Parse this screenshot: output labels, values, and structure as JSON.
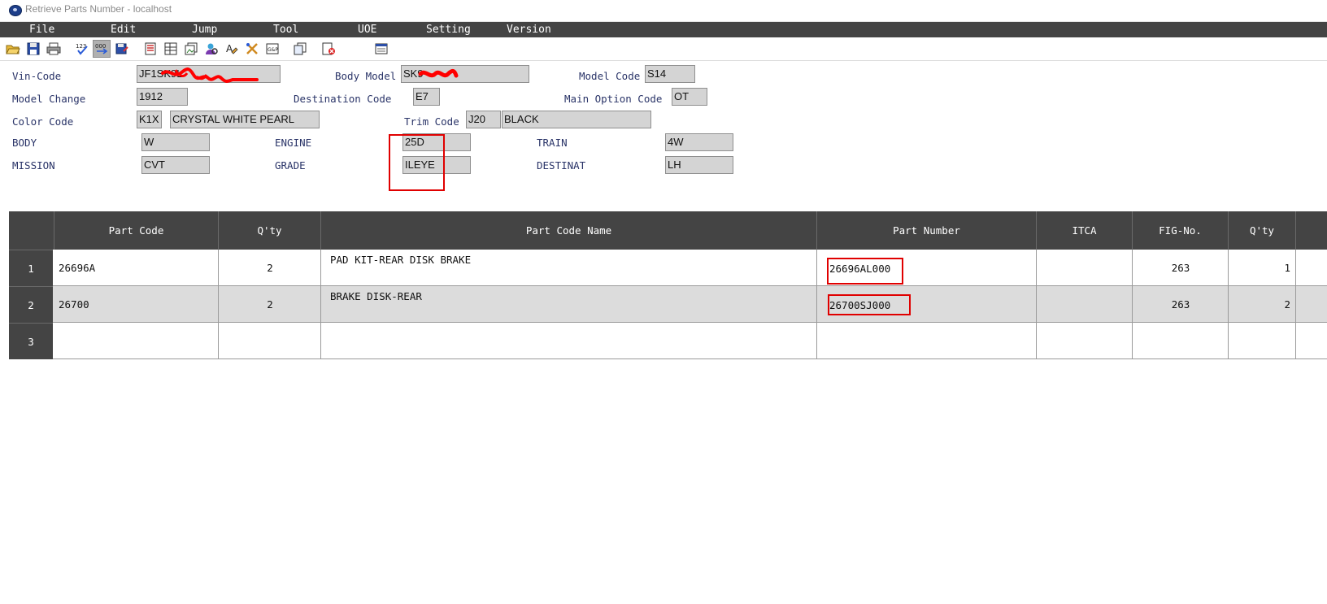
{
  "window": {
    "title": "Retrieve Parts Number - localhost"
  },
  "menu": [
    "File",
    "Edit",
    "Jump",
    "Tool",
    "UOE",
    "Setting",
    "Version"
  ],
  "toolbar_icons": [
    "open-folder-icon",
    "save-icon",
    "print-icon",
    "check-number-icon",
    "number-sequence-icon",
    "save-as-icon",
    "document-list-icon",
    "table-icon",
    "image-stack-icon",
    "search-person-icon",
    "text-edit-icon",
    "tools-icon",
    "gp-icon",
    "copy-documents-icon",
    "exit-icon",
    "window-icon"
  ],
  "form": {
    "vin_code": {
      "label": "Vin-Code",
      "value": "JF1SK9L"
    },
    "body_model": {
      "label": "Body Model",
      "value": "SK9"
    },
    "model_code": {
      "label": "Model Code",
      "value": "S14"
    },
    "model_change": {
      "label": "Model Change",
      "value": "1912"
    },
    "destination_code": {
      "label": "Destination Code",
      "value": "E7"
    },
    "main_option_code": {
      "label": "Main Option Code",
      "value": "OT"
    },
    "color_code": {
      "label": "Color Code",
      "code": "K1X",
      "name": "CRYSTAL WHITE PEARL"
    },
    "trim_code": {
      "label": "Trim Code",
      "code": "J20",
      "name": "BLACK"
    },
    "body": {
      "label": "BODY",
      "value": "W"
    },
    "engine": {
      "label": "ENGINE",
      "value": "25D"
    },
    "train": {
      "label": "TRAIN",
      "value": "4W"
    },
    "mission": {
      "label": "MISSION",
      "value": "CVT"
    },
    "grade": {
      "label": "GRADE",
      "value": "ILEYE"
    },
    "destinat": {
      "label": "DESTINAT",
      "value": "LH"
    }
  },
  "table": {
    "headers": {
      "part_code": "Part Code",
      "qty": "Q'ty",
      "part_code_name": "Part Code Name",
      "part_number": "Part Number",
      "itca": "ITCA",
      "fig_no": "FIG-No.",
      "qty2": "Q'ty"
    },
    "rows": [
      {
        "num": "1",
        "part_code": "26696A",
        "qty": "2",
        "part_code_name": "PAD KIT-REAR DISK BRAKE",
        "part_number": "26696AL000",
        "itca": "",
        "fig_no": "263",
        "qty2": "1"
      },
      {
        "num": "2",
        "part_code": "26700",
        "qty": "2",
        "part_code_name": "BRAKE DISK-REAR",
        "part_number": "26700SJ000",
        "itca": "",
        "fig_no": "263",
        "qty2": "2"
      },
      {
        "num": "3",
        "part_code": "",
        "qty": "",
        "part_code_name": "",
        "part_number": "",
        "itca": "",
        "fig_no": "",
        "qty2": ""
      }
    ]
  },
  "colors": {
    "menu_bg": "#444444",
    "field_bg": "#d4d4d4",
    "highlight": "#e00000",
    "label": "#2a3468"
  }
}
